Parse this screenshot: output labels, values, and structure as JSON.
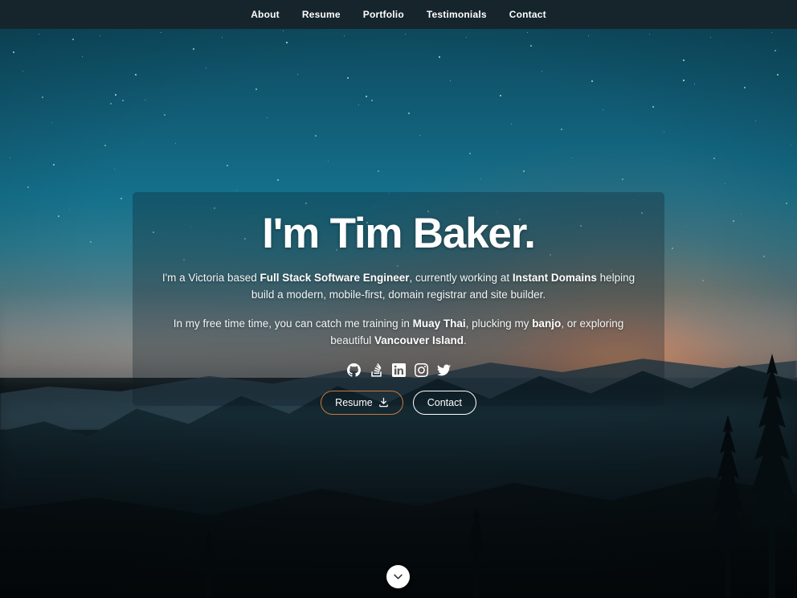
{
  "nav": {
    "items": [
      {
        "label": "About",
        "name": "nav-link-about"
      },
      {
        "label": "Resume",
        "name": "nav-link-resume"
      },
      {
        "label": "Portfolio",
        "name": "nav-link-portfolio"
      },
      {
        "label": "Testimonials",
        "name": "nav-link-testimonials"
      },
      {
        "label": "Contact",
        "name": "nav-link-contact"
      }
    ]
  },
  "hero": {
    "title": "I'm Tim Baker.",
    "paragraph1": {
      "part1": "I'm a Victoria based ",
      "bold1": "Full Stack Software Engineer",
      "part2": ", currently working at ",
      "bold2": "Instant Domains",
      "part3": " helping build a modern, mobile-first, domain registrar and site builder."
    },
    "paragraph2": {
      "part1": "In my free time time, you can catch me training in ",
      "bold1": "Muay Thai",
      "part2": ", plucking my ",
      "bold2": "banjo",
      "part3": ", or exploring beautiful ",
      "bold3": "Vancouver Island",
      "part4": "."
    },
    "social": [
      {
        "label": "GitHub",
        "icon": "github-icon"
      },
      {
        "label": "Stack Overflow",
        "icon": "stackoverflow-icon"
      },
      {
        "label": "LinkedIn",
        "icon": "linkedin-icon"
      },
      {
        "label": "Instagram",
        "icon": "instagram-icon"
      },
      {
        "label": "Twitter",
        "icon": "twitter-icon"
      }
    ],
    "buttons": {
      "resume": "Resume",
      "contact": "Contact"
    }
  },
  "scroll": {
    "icon": "chevron-down-icon"
  },
  "colors": {
    "navbar_background": "#16252c",
    "resume_border": "#c97b3c",
    "contact_border": "#ffffff",
    "text": "#ffffff",
    "sky_top": "#0c4356",
    "sky_mid": "#15718c",
    "sunset_glow": "#ec965c",
    "scroll_button_background": "#ffffff"
  }
}
